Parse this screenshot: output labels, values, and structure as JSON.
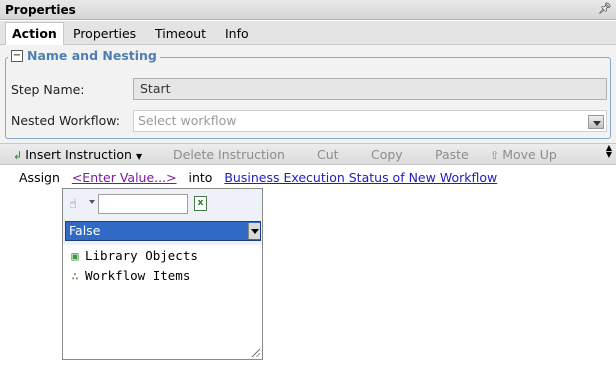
{
  "panel": {
    "title": "Properties",
    "pin_icon": "pin-icon"
  },
  "tabs": [
    {
      "label": "Action",
      "active": true
    },
    {
      "label": "Properties",
      "active": false
    },
    {
      "label": "Timeout",
      "active": false
    },
    {
      "label": "Info",
      "active": false
    }
  ],
  "group": {
    "collapse_symbol": "−",
    "legend": "Name and Nesting",
    "step_name_label": "Step Name:",
    "step_name_value": "Start",
    "nested_workflow_label": "Nested Workflow:",
    "nested_workflow_placeholder": "Select workflow"
  },
  "toolbar": {
    "insert_instruction": "Insert Instruction",
    "delete_instruction": "Delete Instruction",
    "cut": "Cut",
    "copy": "Copy",
    "paste": "Paste",
    "move_up": "Move Up"
  },
  "instruction": {
    "verb": "Assign",
    "value_placeholder": "<Enter Value...>",
    "connector": "into",
    "target": "Business Execution Status of New Workflow"
  },
  "popup": {
    "search_value": "",
    "excel_glyph": "x",
    "selected_value": "False",
    "tree_items": [
      {
        "label": "Library Objects",
        "icon": "library-objects-icon"
      },
      {
        "label": "Workflow Items",
        "icon": "workflow-items-icon"
      }
    ]
  },
  "colors": {
    "accent_legend": "#4f7fb0",
    "selection": "#316ac5",
    "link": "#2020c0",
    "placeholder_link": "#7a1a9a"
  }
}
